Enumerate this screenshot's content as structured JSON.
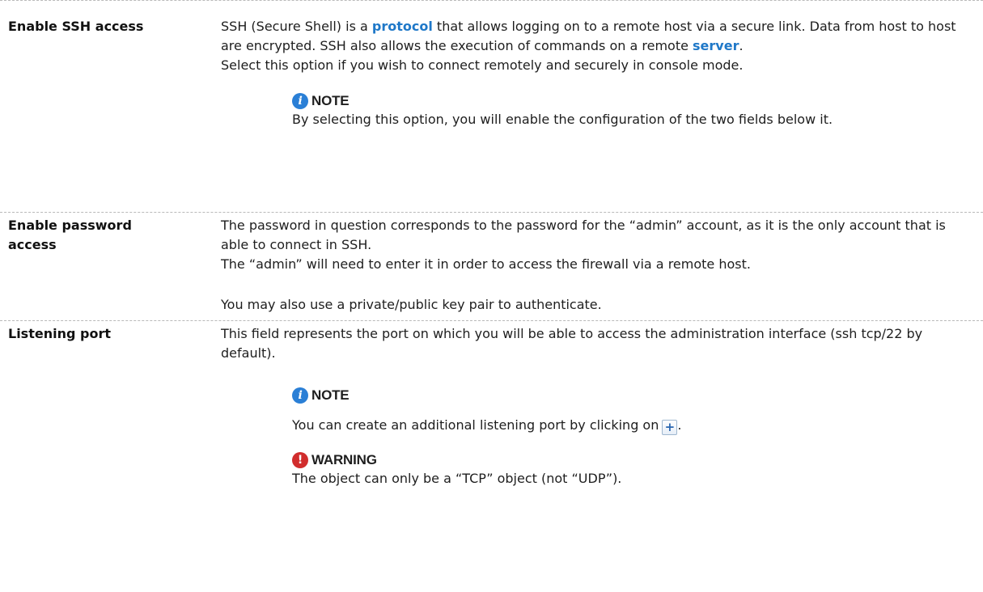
{
  "rows": [
    {
      "term": "Enable SSH access",
      "desc_part1": "SSH (Secure Shell) is a ",
      "desc_link1": "protocol",
      "desc_part2": " that allows logging on to a remote host via a secure link. Data from host to host are encrypted. SSH also allows the execution of commands on a remote ",
      "desc_link2": "server",
      "desc_part3": ".",
      "desc_line2": "Select this option if you wish to connect remotely and securely in console mode.",
      "note": {
        "title": "NOTE",
        "body": "By selecting this option, you will enable the configuration of the two fields below it."
      }
    },
    {
      "term_line1": "Enable password",
      "term_line2": "access",
      "desc_line1": "The password in question corresponds to the password for the “admin” account, as it is the only account that is able to connect in SSH.",
      "desc_line2": "The “admin” will need to enter it in order to access the firewall via a remote host.",
      "desc_line3": "You may also use a private/public key pair to authenticate."
    },
    {
      "term": "Listening port",
      "desc_line1": "This field represents the port on which you will be able to access the administration interface (ssh tcp/22 by default).",
      "note": {
        "title": "NOTE",
        "body_prefix": "You can create an additional listening port by clicking on",
        "body_suffix": ".",
        "button_icon": "plus-icon"
      },
      "warning": {
        "title": "WARNING",
        "body": "The object can only be a “TCP” object (not “UDP”)."
      }
    }
  ],
  "colors": {
    "link": "#1f78c8",
    "note_icon": "#2a7fd6",
    "warning_icon": "#d12d2d",
    "divider": "#b9b9b9"
  }
}
